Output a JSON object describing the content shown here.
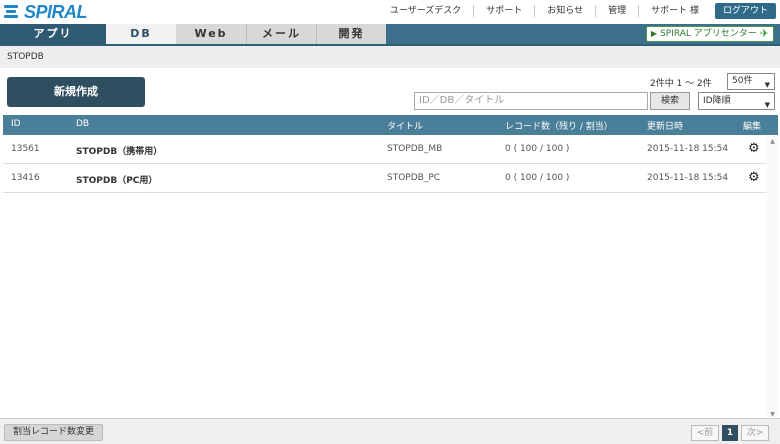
{
  "brand": {
    "name": "SPIRAL"
  },
  "header_links": [
    "ユーザーズデスク",
    "サポート",
    "お知らせ",
    "管理",
    "サポート 様"
  ],
  "logout_label": "ログアウト",
  "nav": {
    "tabs": [
      "アプリ",
      "DB",
      "Web",
      "メール",
      "開発"
    ],
    "active": "DB",
    "app_center_label": "SPIRAL アプリセンター"
  },
  "breadcrumb": "STOPDB",
  "toolbar": {
    "new_label": "新規作成",
    "count_text": "2件中 1 ～ 2件",
    "per_page": "50件",
    "search_placeholder": "ID／DB／タイトル",
    "search_label": "検索",
    "sort": "ID降順"
  },
  "table": {
    "columns": [
      "ID",
      "DB",
      "タイトル",
      "レコード数（残り / 割当）",
      "更新日時",
      "編集"
    ],
    "rows": [
      {
        "id": "13561",
        "db": "STOPDB（携帯用）",
        "title": "STOPDB_MB",
        "records": "0 ( 100 / 100 )",
        "updated": "2015-11-18 15:54"
      },
      {
        "id": "13416",
        "db": "STOPDB（PC用）",
        "title": "STOPDB_PC",
        "records": "0 ( 100 / 100 )",
        "updated": "2015-11-18 15:54"
      }
    ]
  },
  "footer": {
    "quota_label": "割当レコード数変更",
    "prev_label": "<前",
    "current_page": "1",
    "next_label": "次>"
  },
  "colors": {
    "nav": "#3c6f8a",
    "header_row": "#4a7f99",
    "primary_button": "#2f4f60",
    "brand": "#1f86c7"
  },
  "icons": {
    "edit": "gear-icon",
    "app_center": "paper-plane-icon"
  }
}
